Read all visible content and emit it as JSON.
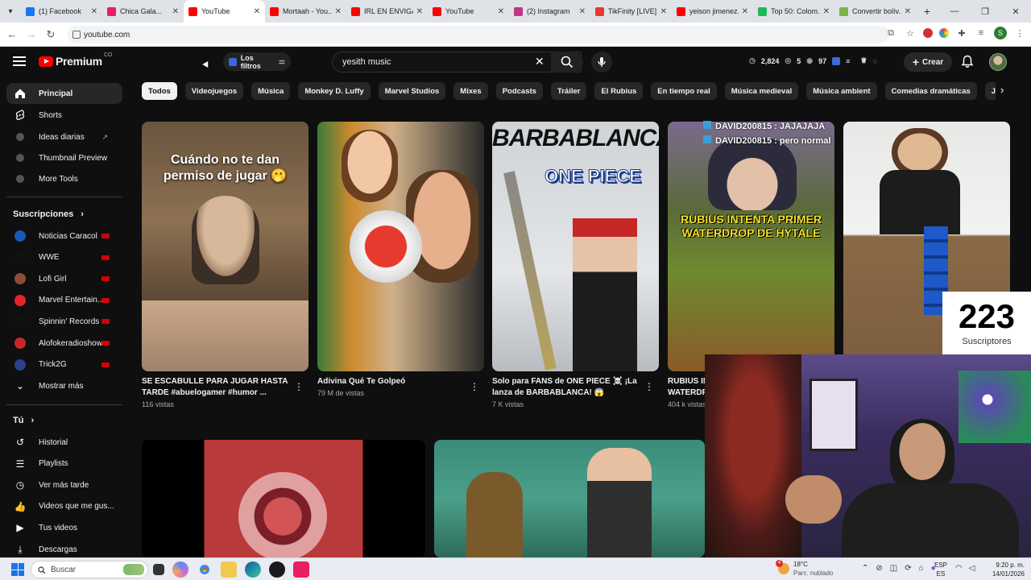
{
  "browser": {
    "tabs": [
      {
        "title": "(1) Facebook",
        "color": "#1877f2"
      },
      {
        "title": "Chica Gala...",
        "color": "#e91e63"
      },
      {
        "title": "YouTube",
        "color": "#ff0000",
        "active": true
      },
      {
        "title": "Mortaah - You...",
        "color": "#ff0000"
      },
      {
        "title": "IRL EN ENVIGA...",
        "color": "#ff0000"
      },
      {
        "title": "YouTube",
        "color": "#ff0000"
      },
      {
        "title": "(2) Instagram",
        "color": "#c13584"
      },
      {
        "title": "TikFinity [LIVE]",
        "color": "#e53935"
      },
      {
        "title": "yeison jimenez...",
        "color": "#ff0000"
      },
      {
        "title": "Top 50: Colom...",
        "color": "#1db954"
      },
      {
        "title": "Convertir bolív...",
        "color": "#7cb342"
      }
    ],
    "url": "youtube.com"
  },
  "header": {
    "logo_text": "Premium",
    "logo_sup": "CO",
    "filters_label": "Los filtros",
    "search_value": "yesith music",
    "stats": [
      "2,824",
      "5",
      "97"
    ],
    "create_label": "Crear"
  },
  "sidebar": {
    "main": [
      {
        "label": "Principal",
        "icon": "home-icon",
        "active": true
      },
      {
        "label": "Shorts",
        "icon": "shorts-icon"
      },
      {
        "label": "Ideas diarias",
        "icon": "extension-icon",
        "ext": true
      },
      {
        "label": "Thumbnail Preview",
        "icon": "extension-icon"
      },
      {
        "label": "More Tools",
        "icon": "extension-icon"
      }
    ],
    "subs_heading": "Suscripciones",
    "subs": [
      {
        "label": "Noticias Caracol",
        "color": "#1a56b3"
      },
      {
        "label": "WWE",
        "color": "#111111"
      },
      {
        "label": "Lofi Girl",
        "color": "#8e4d3a"
      },
      {
        "label": "Marvel Entertain...",
        "color": "#e62429"
      },
      {
        "label": "Spinnin' Records",
        "color": "#111111"
      },
      {
        "label": "Alofokeradioshow",
        "color": "#c62828"
      },
      {
        "label": "Trick2G",
        "color": "#2a3f8f"
      }
    ],
    "show_more": "Mostrar más",
    "you_heading": "Tú",
    "you": [
      {
        "label": "Historial",
        "icon": "history-icon"
      },
      {
        "label": "Playlists",
        "icon": "playlist-icon"
      },
      {
        "label": "Ver más tarde",
        "icon": "clock-icon"
      },
      {
        "label": "Videos que me gus...",
        "icon": "thumbs-up-icon"
      },
      {
        "label": "Tus videos",
        "icon": "video-icon"
      },
      {
        "label": "Descargas",
        "icon": "download-icon"
      }
    ]
  },
  "chips": [
    "Todos",
    "Videojuegos",
    "Música",
    "Monkey D. Luffy",
    "Marvel Studios",
    "Mixes",
    "Podcasts",
    "Tráiler",
    "El Rubius",
    "En tiempo real",
    "Música medieval",
    "Música ambient",
    "Comedias dramáticas",
    "Juegos de aventu..."
  ],
  "videos": [
    {
      "title": "SE ESCABULLE PARA JUGAR HASTA TARDE #abuelogamer #humor ...",
      "meta": "116 vistas",
      "thumb_text": "Cuándo no te dan permiso de jugar 🫢"
    },
    {
      "title": "Adivina Qué Te Golpeó",
      "meta": "79 M de vistas",
      "thumb_text": ""
    },
    {
      "title": "Solo para FANS de ONE PIECE ☠️ ¡La lanza de BARBABLANCA! 😱",
      "meta": "7 K vistas",
      "thumb_text": "BARBABLANCA",
      "thumb_logo": "ONE PIECE"
    },
    {
      "title": "RUBIUS INTENTA PRIMER WATERDROP DE HYTALE",
      "meta": "404 k vistas",
      "thumb_text": "RUBIUS INTENTA PRIMER WATERDROP DE HYTALE"
    },
    {
      "title": "",
      "meta": "",
      "thumb_text": ""
    }
  ],
  "overlay": {
    "chat": [
      "DAVID200815 : JAJAJAJA",
      "DAVID200815 : pero normal"
    ],
    "sub_count": "223",
    "sub_label": "Suscriptores"
  },
  "taskbar": {
    "search_placeholder": "Buscar",
    "weather_temp": "18°C",
    "weather_desc": "Parc. nublado",
    "weather_badge": "4",
    "lang_top": "ESP",
    "lang_bottom": "ES",
    "time": "9:20 p. m.",
    "date": "14/01/2026"
  }
}
